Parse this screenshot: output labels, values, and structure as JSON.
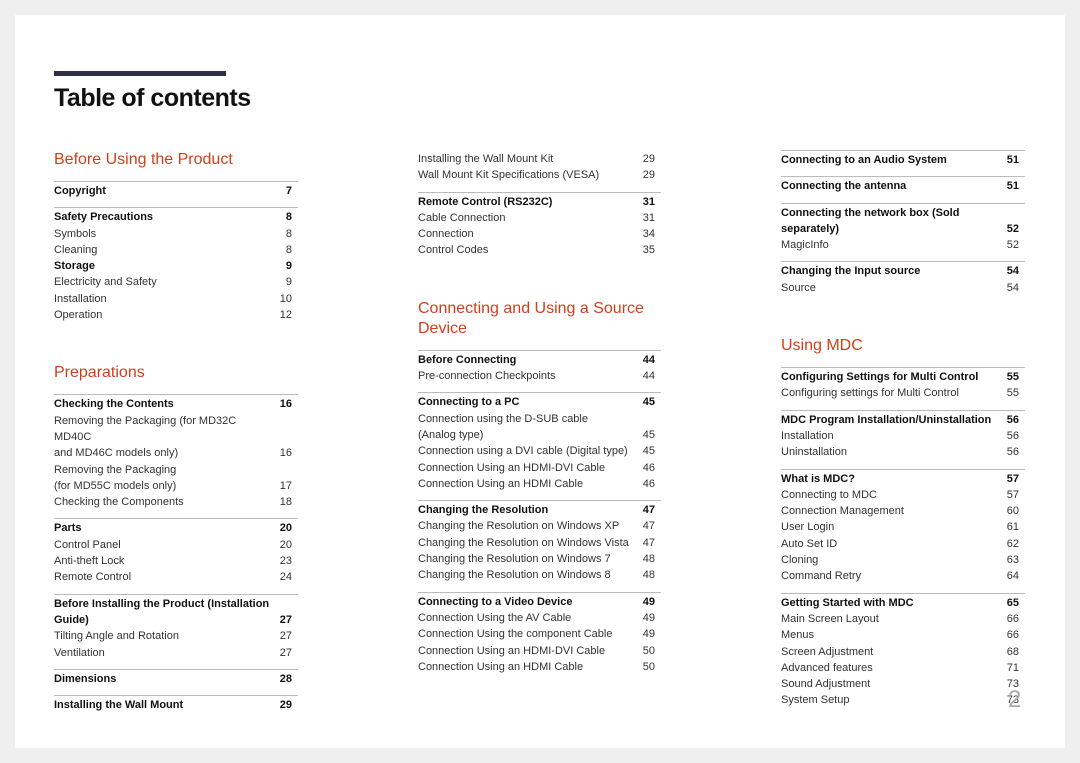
{
  "title": "Table of contents",
  "page_number": "2",
  "accent_color": "#d1401c",
  "columns": [
    {
      "sections": [
        {
          "heading": "Before Using the Product",
          "groups": [
            {
              "entries": [
                {
                  "label": "Copyright",
                  "page": "7",
                  "bold": true
                }
              ]
            },
            {
              "entries": [
                {
                  "label": "Safety Precautions",
                  "page": "8",
                  "bold": true
                },
                {
                  "label": "Symbols",
                  "page": "8"
                },
                {
                  "label": "Cleaning",
                  "page": "8"
                },
                {
                  "label": "Storage",
                  "page": "9",
                  "bold": true
                },
                {
                  "label": "Electricity and Safety",
                  "page": "9"
                },
                {
                  "label": "Installation",
                  "page": "10"
                },
                {
                  "label": "Operation",
                  "page": "12"
                }
              ]
            }
          ]
        },
        {
          "heading": "Preparations",
          "groups": [
            {
              "entries": [
                {
                  "label": "Checking the Contents",
                  "page": "16",
                  "bold": true
                },
                {
                  "label": "Removing the Packaging (for MD32C MD40C\nand MD46C models only)",
                  "page": "16"
                },
                {
                  "label": "Removing the Packaging\n(for MD55C models only)",
                  "page": "17"
                },
                {
                  "label": "Checking the Components",
                  "page": "18"
                }
              ]
            },
            {
              "entries": [
                {
                  "label": "Parts",
                  "page": "20",
                  "bold": true
                },
                {
                  "label": "Control Panel",
                  "page": "20"
                },
                {
                  "label": "Anti-theft Lock",
                  "page": "23"
                },
                {
                  "label": "Remote Control",
                  "page": "24"
                }
              ]
            },
            {
              "entries": [
                {
                  "label": "Before Installing the Product (Installation\nGuide)",
                  "page": "27",
                  "bold": true
                },
                {
                  "label": "Tilting Angle and Rotation",
                  "page": "27"
                },
                {
                  "label": "Ventilation",
                  "page": "27"
                }
              ]
            },
            {
              "entries": [
                {
                  "label": "Dimensions",
                  "page": "28",
                  "bold": true
                }
              ]
            },
            {
              "entries": [
                {
                  "label": "Installing the Wall Mount",
                  "page": "29",
                  "bold": true
                }
              ]
            }
          ]
        }
      ]
    },
    {
      "sections": [
        {
          "heading": "",
          "groups": [
            {
              "norule": true,
              "entries": [
                {
                  "label": "Installing the Wall Mount Kit",
                  "page": "29"
                },
                {
                  "label": "Wall Mount Kit Specifications (VESA)",
                  "page": "29"
                }
              ]
            },
            {
              "entries": [
                {
                  "label": "Remote Control (RS232C)",
                  "page": "31",
                  "bold": true
                },
                {
                  "label": "Cable Connection",
                  "page": "31"
                },
                {
                  "label": "Connection",
                  "page": "34"
                },
                {
                  "label": "Control Codes",
                  "page": "35"
                }
              ]
            }
          ]
        },
        {
          "heading": "Connecting and Using a Source\nDevice",
          "groups": [
            {
              "entries": [
                {
                  "label": "Before Connecting",
                  "page": "44",
                  "bold": true
                },
                {
                  "label": "Pre-connection Checkpoints",
                  "page": "44"
                }
              ]
            },
            {
              "entries": [
                {
                  "label": "Connecting to a PC",
                  "page": "45",
                  "bold": true
                },
                {
                  "label": "Connection using the D-SUB cable\n(Analog type)",
                  "page": "45"
                },
                {
                  "label": "Connection using a DVI cable (Digital type)",
                  "page": "45"
                },
                {
                  "label": "Connection Using an HDMI-DVI Cable",
                  "page": "46"
                },
                {
                  "label": "Connection Using an HDMI Cable",
                  "page": "46"
                }
              ]
            },
            {
              "entries": [
                {
                  "label": "Changing the Resolution",
                  "page": "47",
                  "bold": true
                },
                {
                  "label": "Changing the Resolution on Windows XP",
                  "page": "47"
                },
                {
                  "label": "Changing the Resolution on Windows Vista",
                  "page": "47"
                },
                {
                  "label": "Changing the Resolution on Windows 7",
                  "page": "48"
                },
                {
                  "label": "Changing the Resolution on Windows 8",
                  "page": "48"
                }
              ]
            },
            {
              "entries": [
                {
                  "label": "Connecting to a Video Device",
                  "page": "49",
                  "bold": true
                },
                {
                  "label": "Connection Using the AV Cable",
                  "page": "49"
                },
                {
                  "label": "Connection Using the component Cable",
                  "page": "49"
                },
                {
                  "label": "Connection Using an HDMI-DVI Cable",
                  "page": "50"
                },
                {
                  "label": "Connection Using an HDMI Cable",
                  "page": "50"
                }
              ]
            }
          ]
        }
      ]
    },
    {
      "sections": [
        {
          "heading": "",
          "groups": [
            {
              "entries": [
                {
                  "label": "Connecting to an Audio System",
                  "page": "51",
                  "bold": true
                }
              ]
            },
            {
              "entries": [
                {
                  "label": "Connecting the antenna",
                  "page": "51",
                  "bold": true
                }
              ]
            },
            {
              "entries": [
                {
                  "label": "Connecting the network box (Sold separately)",
                  "page": "52",
                  "bold": true
                },
                {
                  "label": "MagicInfo",
                  "page": "52"
                }
              ]
            },
            {
              "entries": [
                {
                  "label": "Changing the Input source",
                  "page": "54",
                  "bold": true
                },
                {
                  "label": "Source",
                  "page": "54"
                }
              ]
            }
          ]
        },
        {
          "heading": "Using MDC",
          "groups": [
            {
              "entries": [
                {
                  "label": "Configuring Settings for Multi Control",
                  "page": "55",
                  "bold": true
                },
                {
                  "label": "Configuring settings for Multi Control",
                  "page": "55"
                }
              ]
            },
            {
              "entries": [
                {
                  "label": "MDC Program Installation/Uninstallation",
                  "page": "56",
                  "bold": true
                },
                {
                  "label": "Installation",
                  "page": "56"
                },
                {
                  "label": "Uninstallation",
                  "page": "56"
                }
              ]
            },
            {
              "entries": [
                {
                  "label": "What is MDC?",
                  "page": "57",
                  "bold": true
                },
                {
                  "label": "Connecting to MDC",
                  "page": "57"
                },
                {
                  "label": "Connection Management",
                  "page": "60"
                },
                {
                  "label": "User Login",
                  "page": "61"
                },
                {
                  "label": "Auto Set ID",
                  "page": "62"
                },
                {
                  "label": "Cloning",
                  "page": "63"
                },
                {
                  "label": "Command Retry",
                  "page": "64"
                }
              ]
            },
            {
              "entries": [
                {
                  "label": "Getting Started with MDC",
                  "page": "65",
                  "bold": true
                },
                {
                  "label": "Main Screen Layout",
                  "page": "66"
                },
                {
                  "label": "Menus",
                  "page": "66"
                },
                {
                  "label": "Screen Adjustment",
                  "page": "68"
                },
                {
                  "label": "Advanced features",
                  "page": "71"
                },
                {
                  "label": "Sound Adjustment",
                  "page": "73"
                },
                {
                  "label": "System Setup",
                  "page": "73"
                }
              ]
            }
          ]
        }
      ]
    }
  ]
}
